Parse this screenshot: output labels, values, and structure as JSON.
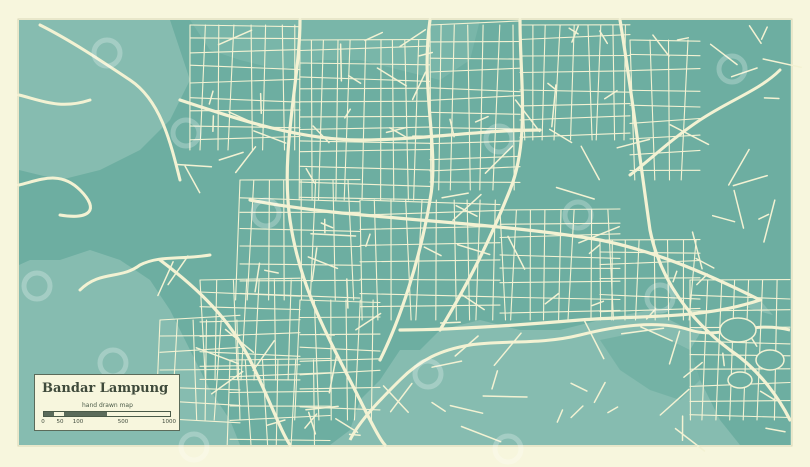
{
  "map": {
    "city_name": "Bandar Lampung",
    "subtitle": "hand drawn map",
    "scale": {
      "labels": [
        "0",
        "50",
        "100",
        "500",
        "1000"
      ]
    },
    "colors": {
      "water": "#8ec1b5",
      "land": "#6eb0a3",
      "roads": "#f3f2d3",
      "background": "#f7f6dd",
      "legend_text": "#3f4a3b",
      "legend_dark": "#5b6b5a"
    }
  }
}
